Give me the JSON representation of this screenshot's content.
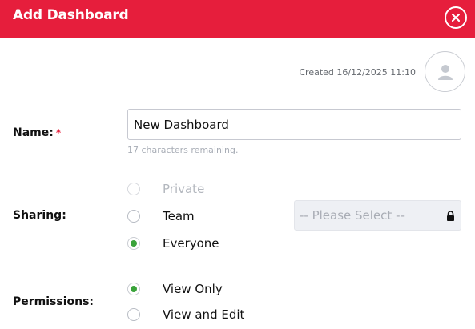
{
  "header": {
    "title": "Add Dashboard",
    "close_icon": "close-icon",
    "bg_color": "#e61e3c"
  },
  "meta": {
    "created": "Created 16/12/2025 11:10",
    "avatar_icon": "user-icon"
  },
  "form": {
    "name": {
      "label": "Name:",
      "required_mark": "*",
      "value": "New Dashboard",
      "hint": "17 characters remaining."
    },
    "sharing": {
      "label": "Sharing:",
      "options": [
        {
          "label": "Private",
          "checked": false,
          "disabled": true
        },
        {
          "label": "Team",
          "checked": false,
          "disabled": false
        },
        {
          "label": "Everyone",
          "checked": true,
          "disabled": false
        }
      ],
      "team_select": {
        "placeholder": "-- Please Select --",
        "locked": true,
        "lock_icon": "lock-icon"
      }
    },
    "permissions": {
      "label": "Permissions:",
      "options": [
        {
          "label": "View Only",
          "checked": true
        },
        {
          "label": "View and Edit",
          "checked": false
        }
      ]
    }
  },
  "colors": {
    "accent": "#e61e3c",
    "radio_checked": "#3aa33a"
  }
}
